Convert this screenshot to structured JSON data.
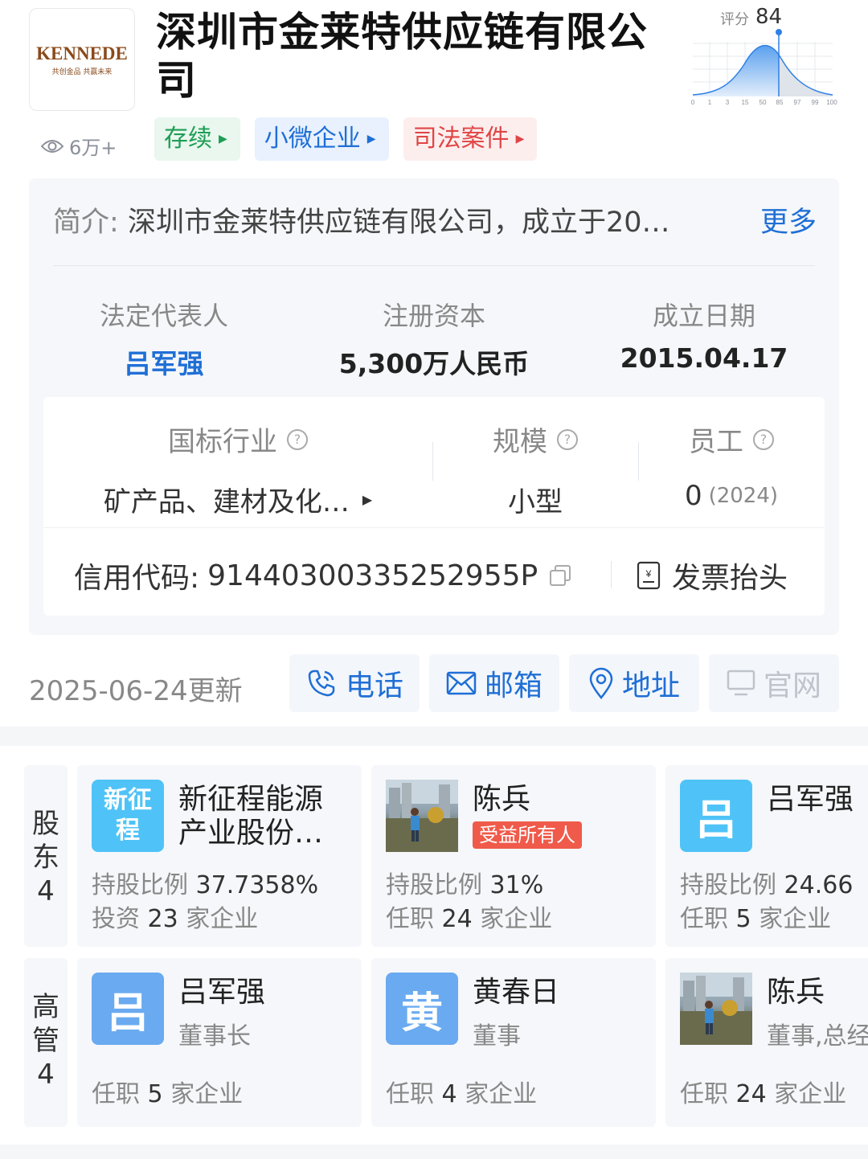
{
  "company": {
    "name": "深圳市金莱特供应链有限公司",
    "logo_word": "KENNEDE",
    "logo_slogan": "共创金品 共赢未来",
    "views": "6万+",
    "tags": [
      {
        "label": "存续",
        "style": "green"
      },
      {
        "label": "小微企业",
        "style": "blue"
      },
      {
        "label": "司法案件",
        "style": "red"
      }
    ],
    "score_label": "评分",
    "score_value": "84",
    "score_ticks": [
      "0",
      "1",
      "3",
      "15",
      "50",
      "85",
      "97",
      "99",
      "100"
    ]
  },
  "info": {
    "intro_label": "简介:",
    "intro_text": "深圳市金莱特供应链有限公司，成立于20…",
    "intro_more": "更多",
    "legal_rep_label": "法定代表人",
    "legal_rep_value": "吕军强",
    "capital_label": "注册资本",
    "capital_value": "5,300万人民币",
    "founded_label": "成立日期",
    "founded_value": "2015.04.17",
    "industry_label": "国标行业",
    "industry_value": "矿产品、建材及化…",
    "scale_label": "规模",
    "scale_value": "小型",
    "staff_label": "员工",
    "staff_value": "0",
    "staff_year": "(2024)",
    "credit_label": "信用代码:",
    "credit_value": "91440300335252955P",
    "invoice_label": "发票抬头"
  },
  "contacts": {
    "updated": "2025-06-24更新",
    "phone": "电话",
    "email": "邮箱",
    "address": "地址",
    "website": "官网"
  },
  "shareholders": {
    "label": "股东",
    "count": "4",
    "items": [
      {
        "avatar_text": "新征程",
        "name": "新征程能源产业股份…",
        "ratio_label": "持股比例",
        "ratio": "37.7358%",
        "line2_prefix": "投资",
        "line2_num": "23",
        "line2_suffix": "家企业"
      },
      {
        "name": "陈兵",
        "badge": "受益所有人",
        "ratio_label": "持股比例",
        "ratio": "31%",
        "line2_prefix": "任职",
        "line2_num": "24",
        "line2_suffix": "家企业"
      },
      {
        "avatar_text": "吕",
        "name": "吕军强",
        "ratio_label": "持股比例",
        "ratio": "24.66",
        "line2_prefix": "任职",
        "line2_num": "5",
        "line2_suffix": "家企业"
      }
    ]
  },
  "executives": {
    "label": "高管",
    "count": "4",
    "items": [
      {
        "avatar_text": "吕",
        "name": "吕军强",
        "role": "董事长",
        "line_prefix": "任职",
        "line_num": "5",
        "line_suffix": "家企业"
      },
      {
        "avatar_text": "黄",
        "name": "黄春日",
        "role": "董事",
        "line_prefix": "任职",
        "line_num": "4",
        "line_suffix": "家企业"
      },
      {
        "name": "陈兵",
        "role": "董事,总经",
        "line_prefix": "任职",
        "line_num": "24",
        "line_suffix": "家企业"
      }
    ]
  }
}
